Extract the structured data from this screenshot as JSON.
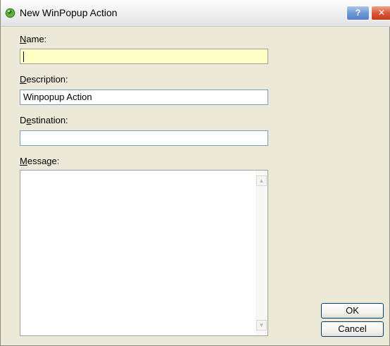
{
  "window": {
    "title": "New WinPopup Action",
    "help_label": "?",
    "close_label": "✕"
  },
  "form": {
    "name": {
      "label_prefix": "",
      "label_mnemonic": "N",
      "label_rest": "ame:",
      "value": ""
    },
    "description": {
      "label_prefix": "",
      "label_mnemonic": "D",
      "label_rest": "escription:",
      "value": "Winpopup Action"
    },
    "destination": {
      "label_prefix": "D",
      "label_mnemonic": "e",
      "label_rest": "stination:",
      "value": ""
    },
    "message": {
      "label_prefix": "",
      "label_mnemonic": "M",
      "label_rest": "essage:",
      "value": ""
    }
  },
  "buttons": {
    "ok_label": "OK",
    "cancel_label": "Cancel"
  },
  "icons": {
    "app": "green-globe-icon",
    "help": "help-icon",
    "close": "close-icon",
    "scroll_up": "chevron-up-icon",
    "scroll_down": "chevron-down-icon"
  },
  "colors": {
    "focused_field_bg": "#ffffc5",
    "dialog_bg": "#ece9d8",
    "close_button": "#d9573a",
    "help_button": "#6f99d6"
  }
}
